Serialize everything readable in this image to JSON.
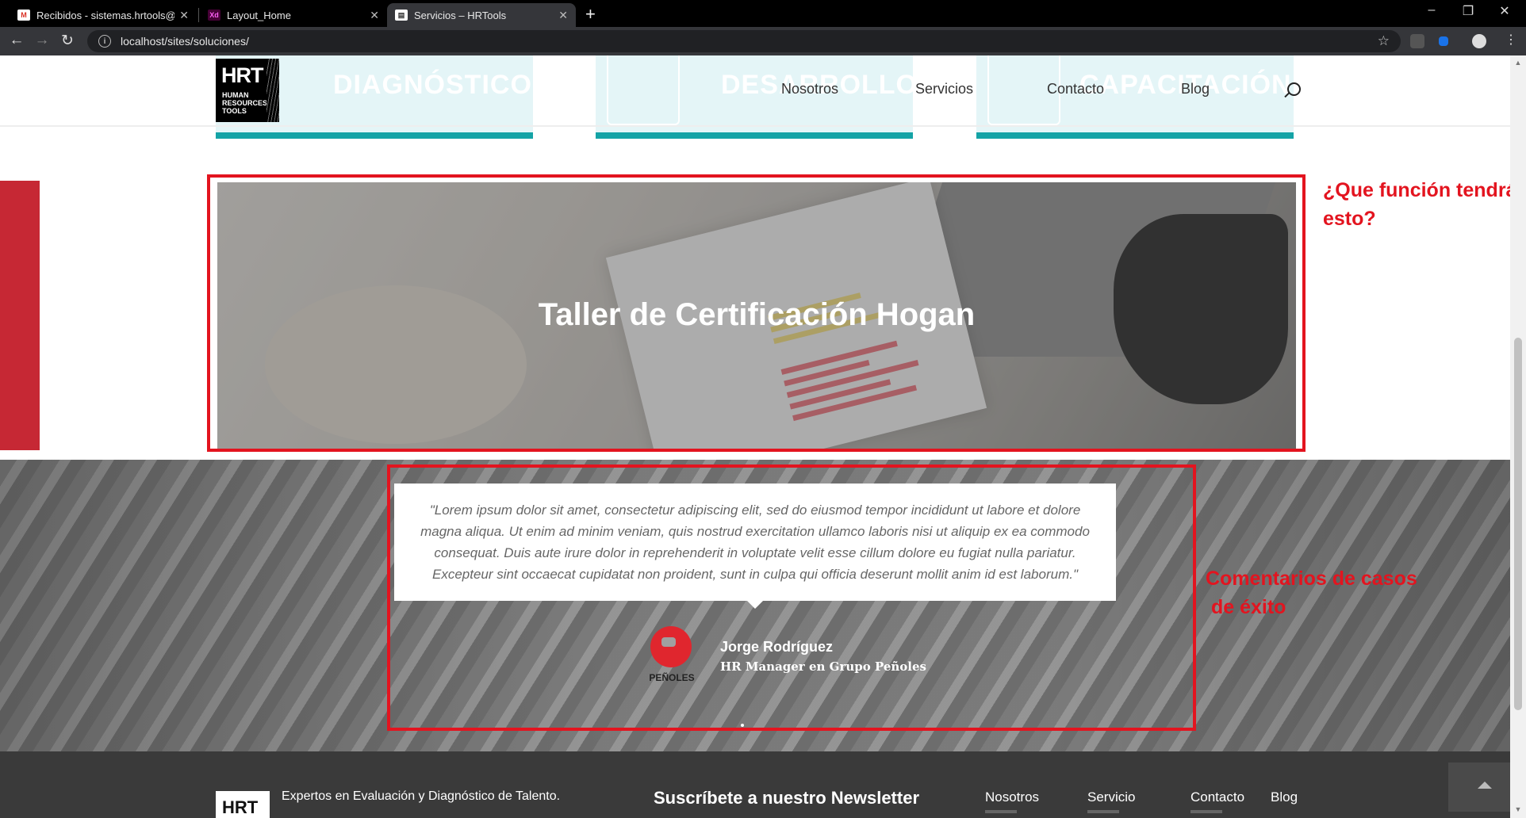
{
  "browser": {
    "tabs": [
      {
        "title": "Recibidos - sistemas.hrtools@gm",
        "icon": "gmail-icon"
      },
      {
        "title": "Layout_Home",
        "icon": "xd-icon"
      },
      {
        "title": "Servicios – HRTools",
        "icon": "page-icon"
      }
    ],
    "url": "localhost/sites/soluciones/"
  },
  "header": {
    "logo": {
      "big": "HRT",
      "small": [
        "HUMAN",
        "RESOURCES",
        "TOOLS"
      ]
    },
    "cards": [
      "DIAGNÓSTICO",
      "DESARROLLO",
      "CAPACITACIÓN"
    ],
    "menu": [
      "Nosotros",
      "Servicios",
      "Contacto",
      "Blog"
    ]
  },
  "hero": {
    "title": "Taller de Certificación Hogan"
  },
  "annotations": {
    "hero_note": "¿Que función tendrá\nesto?",
    "testimonial_note": "Comentarios de casos\n de éxito"
  },
  "testimonial": {
    "quote": "\"Lorem ipsum dolor sit amet, consectetur adipiscing elit, sed do eiusmod tempor incididunt ut labore et dolore magna aliqua. Ut enim ad minim veniam, quis nostrud exercitation ullamco laboris nisi ut aliquip ex ea commodo consequat. Duis aute irure dolor in reprehenderit in voluptate velit esse cillum dolore eu fugiat nulla pariatur. Excepteur sint occaecat cupidatat non proident, sunt in culpa qui officia deserunt mollit anim id est laborum.\"",
    "company_logo_text": "PEÑOLES",
    "author": "Jorge Rodríguez",
    "role": "HR Manager en Grupo Peñoles"
  },
  "footer": {
    "logo": "HRT",
    "tagline": "Expertos en Evaluación y Diagnóstico de Talento.",
    "newsletter": "Suscríbete a nuestro Newsletter",
    "links": [
      "Nosotros",
      "Servicio",
      "Contacto",
      "Blog"
    ]
  },
  "colors": {
    "accent": "#14a3a6",
    "brand_red": "#c62834",
    "annotation_red": "#e3141f"
  }
}
